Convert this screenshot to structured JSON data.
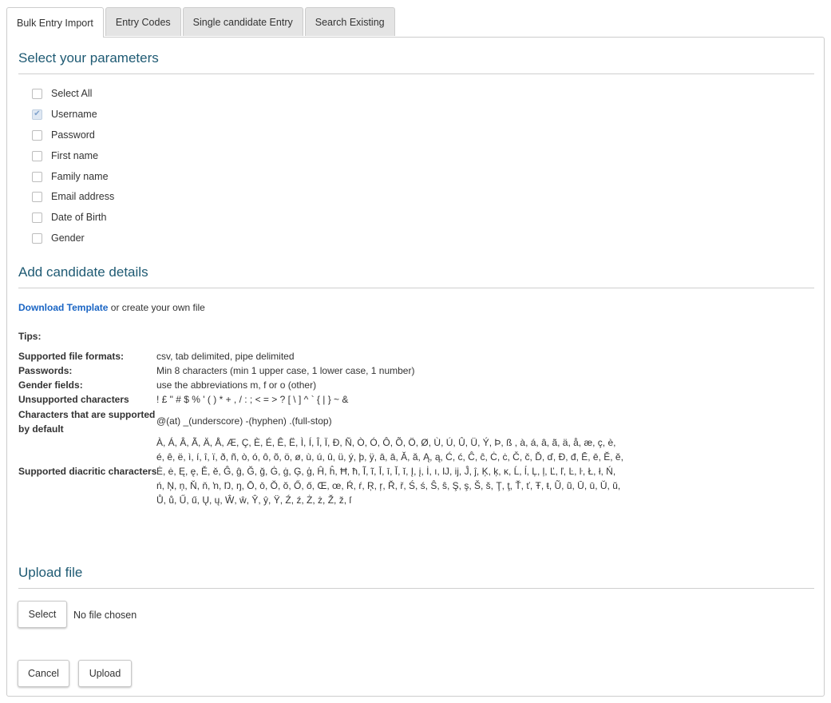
{
  "tabs": [
    {
      "label": "Bulk Entry Import"
    },
    {
      "label": "Entry Codes"
    },
    {
      "label": "Single candidate Entry"
    },
    {
      "label": "Search Existing"
    }
  ],
  "params": {
    "title": "Select your parameters",
    "options": [
      {
        "label": "Select All",
        "checked": false
      },
      {
        "label": "Username",
        "checked": true
      },
      {
        "label": "Password",
        "checked": false
      },
      {
        "label": "First name",
        "checked": false
      },
      {
        "label": "Family name",
        "checked": false
      },
      {
        "label": "Email address",
        "checked": false
      },
      {
        "label": "Date of Birth",
        "checked": false
      },
      {
        "label": "Gender",
        "checked": false
      }
    ]
  },
  "details": {
    "title": "Add candidate details",
    "download_link": "Download Template",
    "download_suffix": " or create your own file",
    "tips_title": "Tips:",
    "tips": [
      {
        "label": "Supported file formats:",
        "value": "csv, tab delimited, pipe delimited"
      },
      {
        "label": "Passwords:",
        "value": "Min 8 characters (min 1 upper case, 1 lower case, 1 number)"
      },
      {
        "label": "Gender fields:",
        "value": "use the abbreviations m, f or o (other)"
      },
      {
        "label": "Unsupported characters",
        "value": "! £ \" # $ % ' ( ) * + , / : ; < = > ? [ \\ ] ^ ` { | } ~ &"
      },
      {
        "label": "Characters that are supported by default",
        "value": "@(at) _(underscore) -(hyphen) .(full-stop)"
      },
      {
        "label": "Supported diacritic characters",
        "value": "À, Á, Â, Ã, Ä, Å, Æ, Ç, È, É, Ê, Ë, Ì, Í, Î, Ï, Ð, Ñ, Ò, Ó, Ô, Õ, Ö, Ø, Ù, Ú, Û, Ü, Ý, Þ, ß , à, á, â, ã, ä, å, æ, ç, è, é, ê, ë, ì, í, î, ï, ð, ñ, ò, ó, ô, õ, ö, ø, ù, ú, û, ü, ý, þ, ÿ, ā, ā, Ă, ă, Ą, ą, Ć, ć, Ĉ, ĉ, Ċ, ċ, Č, č, Ď, ď, Đ, đ, Ē, ē, Ĕ, ĕ, Ė, ė, Ę, ę, Ě, ě, Ĝ, ĝ, Ğ, ğ, Ġ, ġ, Ģ, ģ, Ĥ, ĥ, Ħ, ħ, Ĩ, ĩ, Ī, ī, Ĭ, ĭ, Į, į, İ, ı, Ĳ, ĳ, Ĵ, ĵ, Ķ, ķ, ĸ, Ĺ, ĺ, Ļ, ļ, Ľ, ľ, Ŀ, ŀ, Ł, ł, Ń, ń, Ņ, ņ, Ň, ň, ŉ, Ŋ, ŋ, Ō, ō, Ŏ, ŏ, Ő, ő, Œ, œ, Ŕ, ŕ, Ŗ, ŗ, Ř, ř, Ś, ś, Ŝ, ŝ, Ş, ş, Š, š, Ţ, ţ, Ť, ť, Ŧ, ŧ, Ũ, ũ, Ū, ū, Ŭ, ŭ, Ů, ů, Ű, ű, Ų, ų, Ŵ, ŵ, Ŷ, ŷ, Ÿ, Ź, ź, Ż, ż, Ž, ž, ſ"
      }
    ]
  },
  "upload": {
    "title": "Upload file",
    "select_label": "Select",
    "file_status": "No file chosen",
    "cancel_label": "Cancel",
    "upload_label": "Upload"
  }
}
